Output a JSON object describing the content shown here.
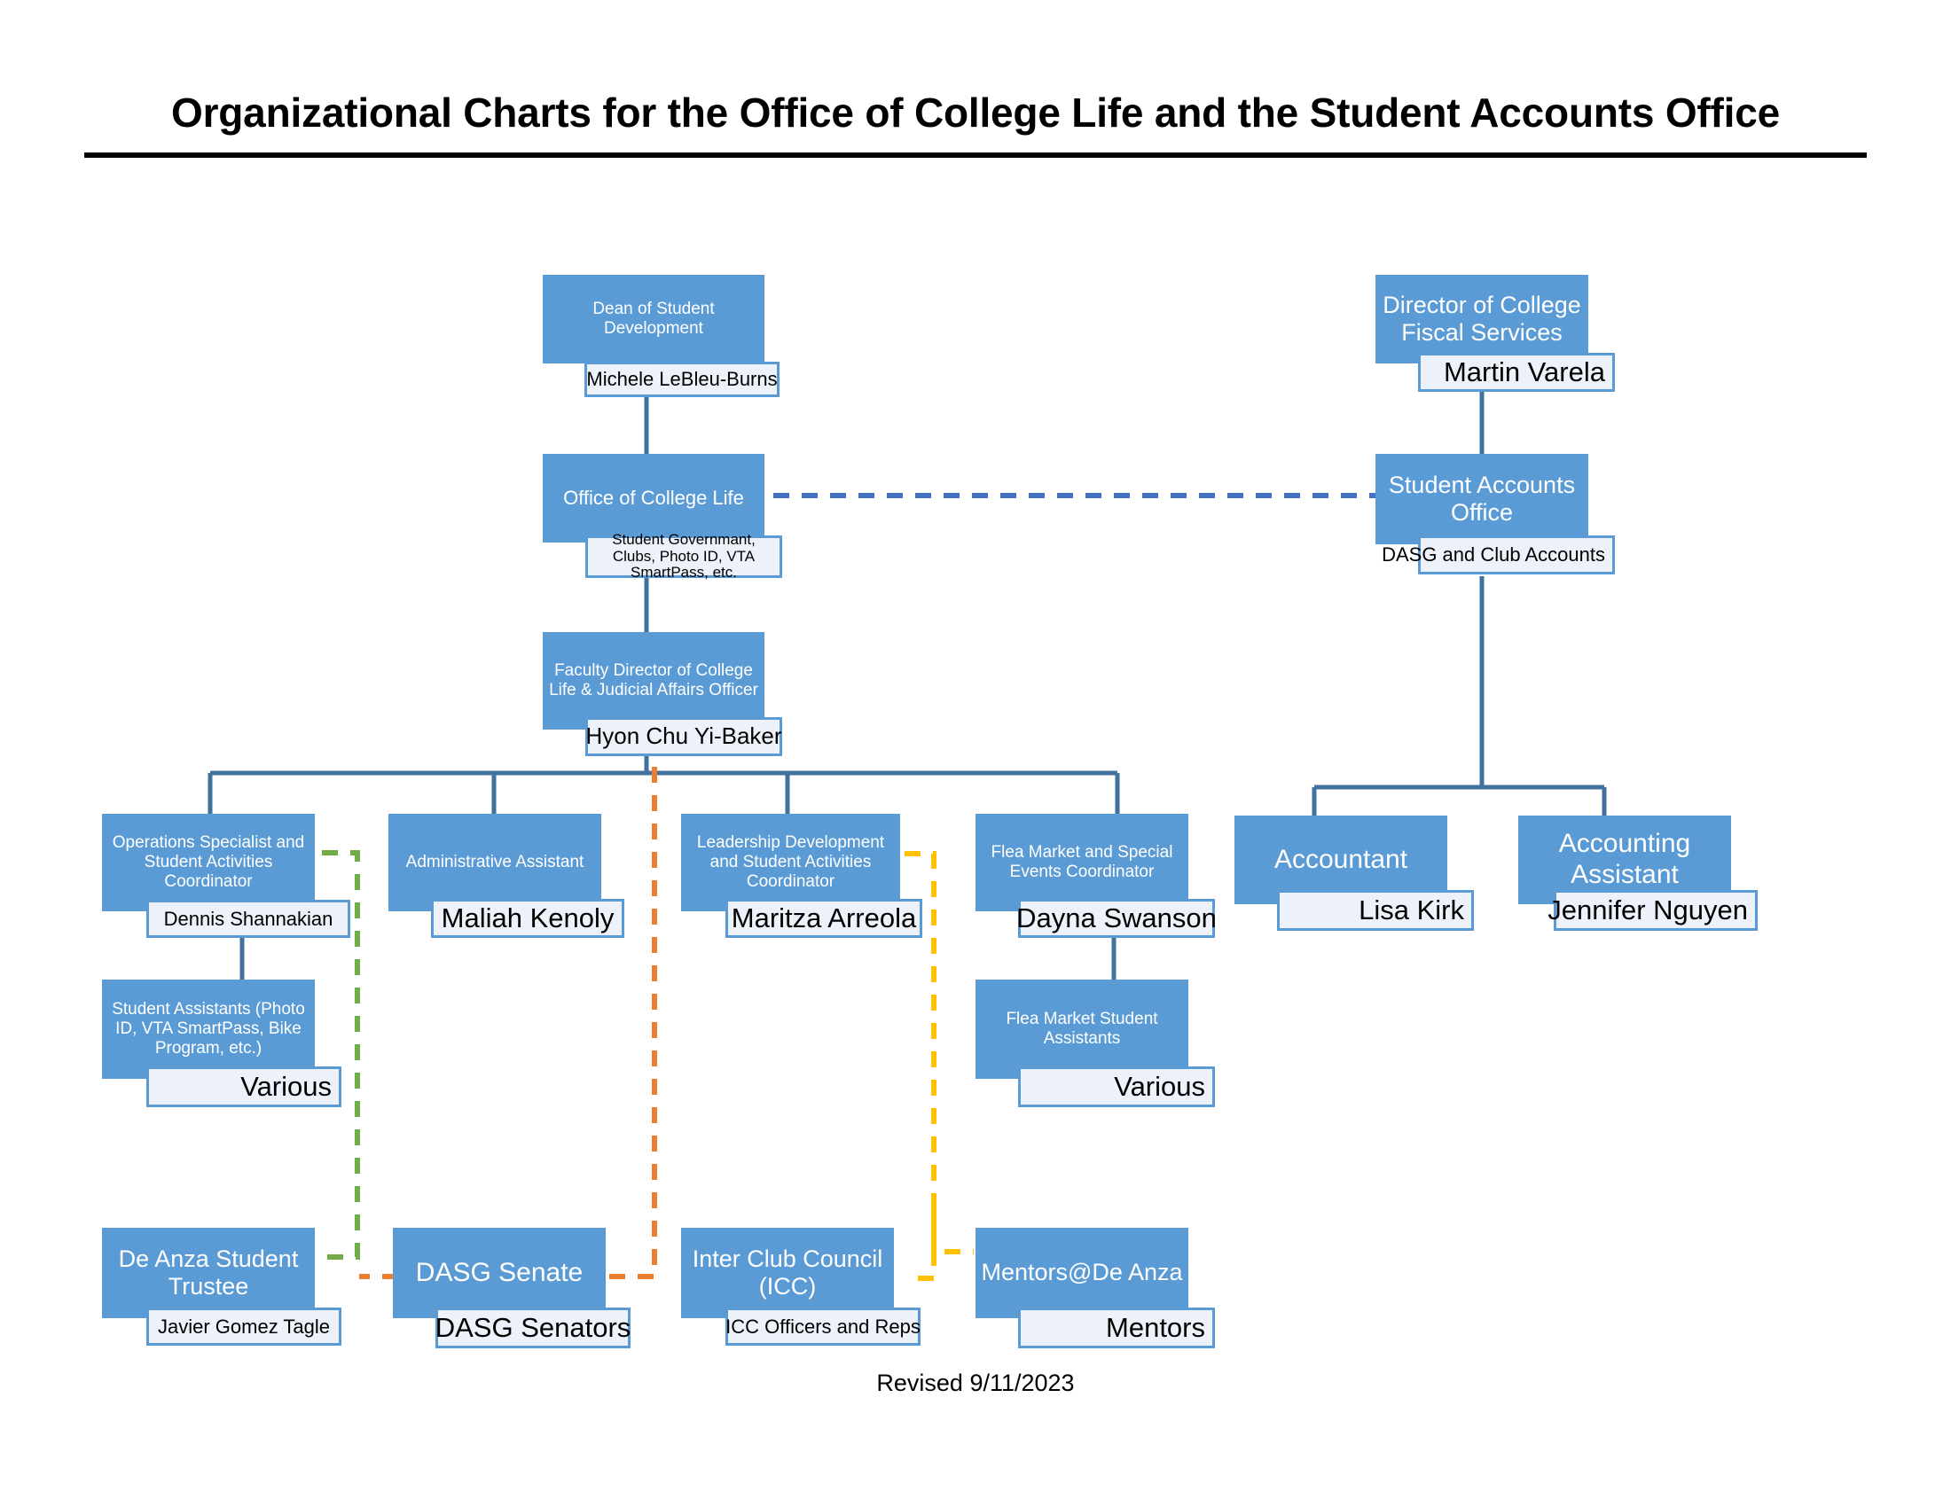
{
  "page": {
    "title": "Organizational Charts for the Office of College Life and the Student Accounts Office",
    "footer": "Revised 9/11/2023"
  },
  "colors": {
    "box_fill": "#5B9BD5",
    "box_text": "#FFFFFF",
    "plate_fill": "#EDF2FA",
    "plate_border": "#5B9BD5",
    "plate_text": "#000000",
    "connector_blue": "#41719C",
    "dashed_blue": "#4472C4",
    "dashed_green": "#70AD47",
    "dashed_orange": "#ED7D31",
    "dashed_yellow": "#FFC000",
    "title_rule": "#000000"
  },
  "nodes": {
    "dean": {
      "title": "Dean of Student Development",
      "name": "Michele LeBleu-Burns"
    },
    "office_college_life": {
      "title": "Office of College Life",
      "name": "Student Governmant, Clubs, Photo ID, VTA SmartPass, etc."
    },
    "faculty_director": {
      "title": "Faculty Director of College Life & Judicial Affairs Officer",
      "name": "Hyon Chu Yi-Baker"
    },
    "operations_specialist": {
      "title": "Operations Specialist and Student Activities Coordinator",
      "name": "Dennis Shannakian"
    },
    "admin_assistant": {
      "title": "Administrative Assistant",
      "name": "Maliah Kenoly"
    },
    "leadership_dev": {
      "title": "Leadership Development and Student Activities Coordinator",
      "name": "Maritza Arreola"
    },
    "flea_market_coord": {
      "title": "Flea Market and Special Events Coordinator",
      "name": "Dayna Swanson"
    },
    "student_assistants": {
      "title": "Student Assistants (Photo ID, VTA SmartPass, Bike Program, etc.)",
      "name": "Various"
    },
    "flea_market_assistants": {
      "title": "Flea Market Student Assistants",
      "name": "Various"
    },
    "student_trustee": {
      "title": "De Anza Student Trustee",
      "name": "Javier Gomez Tagle"
    },
    "dasg_senate": {
      "title": "DASG Senate",
      "name": "DASG Senators"
    },
    "icc": {
      "title": "Inter Club Council (ICC)",
      "name": "ICC Officers and Reps"
    },
    "mentors": {
      "title": "Mentors@De Anza",
      "name": "Mentors"
    },
    "director_fiscal": {
      "title": "Director of College Fiscal Services",
      "name": "Martin Varela"
    },
    "student_accounts": {
      "title": "Student Accounts Office",
      "name": "DASG and Club Accounts"
    },
    "accountant": {
      "title": "Accountant",
      "name": "Lisa Kirk"
    },
    "accounting_assistant": {
      "title": "Accounting Assistant",
      "name": "Jennifer Nguyen"
    }
  },
  "chart_data": {
    "type": "diagram",
    "title": "Organizational Charts for the Office of College Life and the Student Accounts Office",
    "charts": [
      {
        "name": "Office of College Life",
        "hierarchy": [
          {
            "title": "Dean of Student Development",
            "person": "Michele LeBleu-Burns",
            "children": [
              {
                "title": "Office of College Life",
                "person": "Student Governmant, Clubs, Photo ID, VTA SmartPass, etc.",
                "children": [
                  {
                    "title": "Faculty Director of College Life & Judicial Affairs Officer",
                    "person": "Hyon Chu Yi-Baker",
                    "children": [
                      {
                        "title": "Operations Specialist and Student Activities Coordinator",
                        "person": "Dennis Shannakian",
                        "children": [
                          {
                            "title": "Student Assistants (Photo ID, VTA SmartPass, Bike Program, etc.)",
                            "person": "Various"
                          }
                        ]
                      },
                      {
                        "title": "Administrative Assistant",
                        "person": "Maliah Kenoly"
                      },
                      {
                        "title": "Leadership Development and Student Activities Coordinator",
                        "person": "Maritza Arreola"
                      },
                      {
                        "title": "Flea Market and Special Events Coordinator",
                        "person": "Dayna Swanson",
                        "children": [
                          {
                            "title": "Flea Market Student Assistants",
                            "person": "Various"
                          }
                        ]
                      }
                    ]
                  }
                ]
              }
            ]
          }
        ]
      },
      {
        "name": "Student Accounts Office",
        "hierarchy": [
          {
            "title": "Director of College Fiscal Services",
            "person": "Martin Varela",
            "children": [
              {
                "title": "Student Accounts Office",
                "person": "DASG and Club Accounts",
                "children": [
                  {
                    "title": "Accountant",
                    "person": "Lisa Kirk"
                  },
                  {
                    "title": "Accounting Assistant",
                    "person": "Jennifer Nguyen"
                  }
                ]
              }
            ]
          }
        ]
      }
    ],
    "dashed_links": [
      {
        "color": "#4472C4",
        "style": "dashed",
        "from": "Office of College Life",
        "to": "Student Accounts Office"
      },
      {
        "color": "#70AD47",
        "style": "dashed",
        "from": "Operations Specialist and Student Activities Coordinator",
        "to": "De Anza Student Trustee"
      },
      {
        "color": "#ED7D31",
        "style": "dashed",
        "from": "Faculty Director of College Life & Judicial Affairs Officer",
        "to": "DASG Senate"
      },
      {
        "color": "#FFC000",
        "style": "dashed",
        "from": "Leadership Development and Student Activities Coordinator",
        "to": "Inter Club Council (ICC)"
      },
      {
        "color": "#FFC000",
        "style": "dashed",
        "from": "Leadership Development and Student Activities Coordinator",
        "to": "Mentors@De Anza"
      }
    ]
  }
}
